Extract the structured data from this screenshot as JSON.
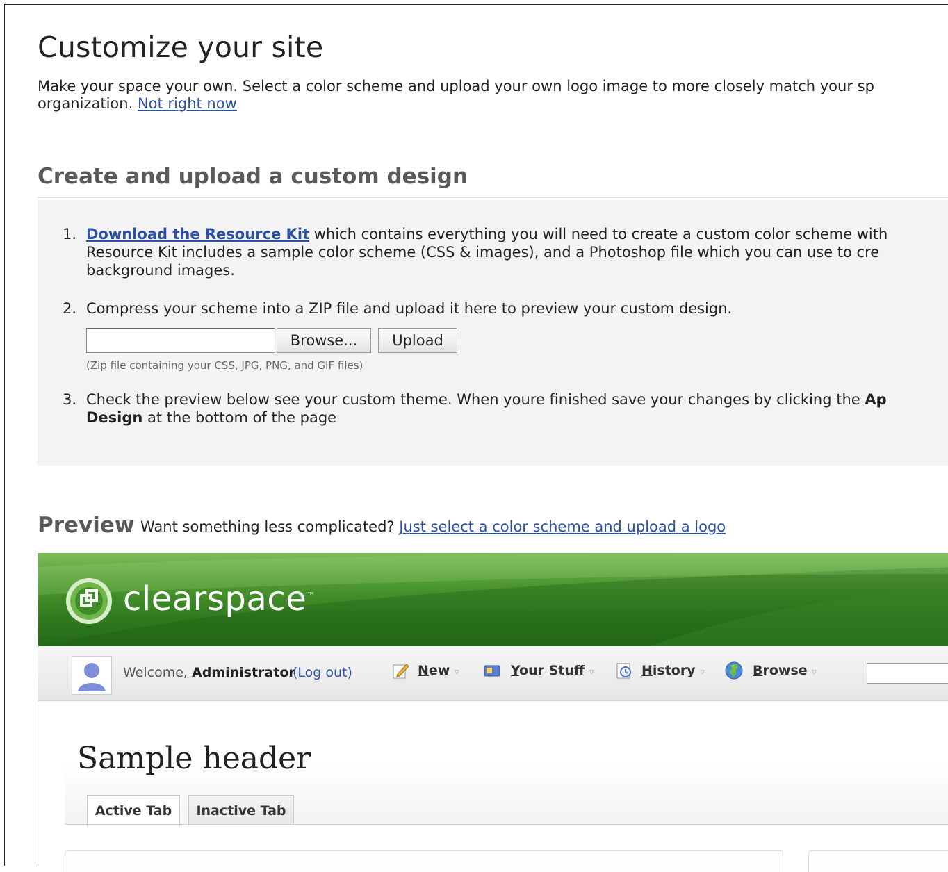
{
  "page": {
    "title": "Customize your site",
    "intro_line1": "Make your space your own. Select a color scheme and upload your own logo image to more closely match your sp",
    "intro_line2_text": "organization.",
    "intro_link": "Not right now"
  },
  "custom_design": {
    "heading": "Create and upload a custom design",
    "step1": {
      "num": "1.",
      "link": "Download the Resource Kit",
      "line1_rest": " which contains everything you will need to create a custom color scheme with",
      "line2": "Resource Kit includes a sample color scheme (CSS & images), and a Photoshop file which you can use to cre",
      "line3": "background images."
    },
    "step2": {
      "num": "2.",
      "text": "Compress your scheme into a ZIP file and upload it here to preview your custom design.",
      "file_value": "",
      "browse_label": "Browse...",
      "upload_label": "Upload",
      "hint": "(Zip file containing your CSS, JPG, PNG, and GIF files)"
    },
    "step3": {
      "num": "3.",
      "line1": "Check the preview below see your custom theme. When youre finished save your changes by clicking the ",
      "line1_bold": "Ap",
      "line2_bold": "Design",
      "line2_rest": " at the bottom of the page"
    }
  },
  "preview": {
    "heading": "Preview",
    "subtext": "Want something less complicated? ",
    "sublink": "Just select a color scheme and upload a logo",
    "logo_text": "clearspace",
    "logo_tm": "™",
    "welcome_prefix": "Welcome, ",
    "welcome_user": "Administrator",
    "logout": "(Log out)",
    "menus": [
      {
        "first": "N",
        "rest": "ew",
        "icon": "new-document-icon"
      },
      {
        "first": "Y",
        "rest": "our Stuff",
        "icon": "your-stuff-icon"
      },
      {
        "first": "H",
        "rest": "istory",
        "icon": "history-icon"
      },
      {
        "first": "B",
        "rest": "rowse",
        "icon": "browse-globe-icon"
      }
    ],
    "caret": "▿",
    "search_value": "",
    "sample_header": "Sample header",
    "tabs": [
      "Active Tab",
      "Inactive Tab"
    ],
    "colors": {
      "banner": "#2f7a1e",
      "link": "#2b50a6"
    }
  }
}
